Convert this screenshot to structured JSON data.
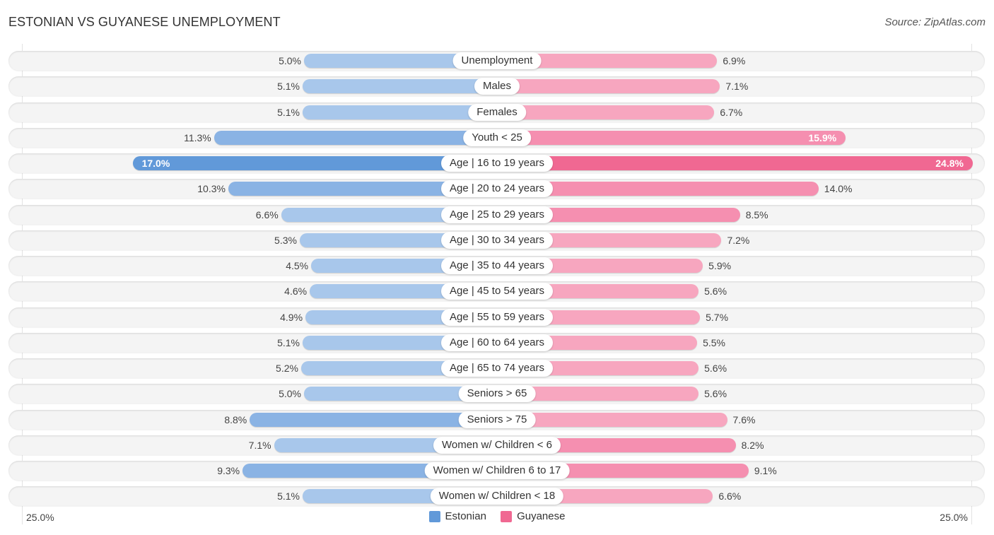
{
  "title": "ESTONIAN VS GUYANESE UNEMPLOYMENT",
  "source": "Source: ZipAtlas.com",
  "colors": {
    "estonian_strong": "#6199d9",
    "estonian_mid": "#8ab3e4",
    "estonian_light": "#a8c7eb",
    "guyanese_strong": "#f06892",
    "guyanese_mid": "#f58fb0",
    "guyanese_light": "#f7a6bf"
  },
  "chart_data": {
    "type": "bar",
    "orientation": "horizontal-diverging",
    "title": "ESTONIAN VS GUYANESE UNEMPLOYMENT",
    "xlabel": "",
    "ylabel": "",
    "axis_min_label": "25.0%",
    "axis_max_label": "25.0%",
    "xlim": [
      0,
      25
    ],
    "legend_position": "bottom-center",
    "categories": [
      "Unemployment",
      "Males",
      "Females",
      "Youth < 25",
      "Age | 16 to 19 years",
      "Age | 20 to 24 years",
      "Age | 25 to 29 years",
      "Age | 30 to 34 years",
      "Age | 35 to 44 years",
      "Age | 45 to 54 years",
      "Age | 55 to 59 years",
      "Age | 60 to 64 years",
      "Age | 65 to 74 years",
      "Seniors > 65",
      "Seniors > 75",
      "Women w/ Children < 6",
      "Women w/ Children 6 to 17",
      "Women w/ Children < 18"
    ],
    "series": [
      {
        "name": "Estonian",
        "side": "left",
        "values": [
          5.0,
          5.1,
          5.1,
          11.3,
          17.0,
          10.3,
          6.6,
          5.3,
          4.5,
          4.6,
          4.9,
          5.1,
          5.2,
          5.0,
          8.8,
          7.1,
          9.3,
          5.1
        ],
        "labels": [
          "5.0%",
          "5.1%",
          "5.1%",
          "11.3%",
          "17.0%",
          "10.3%",
          "6.6%",
          "5.3%",
          "4.5%",
          "4.6%",
          "4.9%",
          "5.1%",
          "5.2%",
          "5.0%",
          "8.8%",
          "7.1%",
          "9.3%",
          "5.1%"
        ]
      },
      {
        "name": "Guyanese",
        "side": "right",
        "values": [
          6.9,
          7.1,
          6.7,
          15.9,
          24.8,
          14.0,
          8.5,
          7.2,
          5.9,
          5.6,
          5.7,
          5.5,
          5.6,
          5.6,
          7.6,
          8.2,
          9.1,
          6.6
        ],
        "labels": [
          "6.9%",
          "7.1%",
          "6.7%",
          "15.9%",
          "24.8%",
          "14.0%",
          "8.5%",
          "7.2%",
          "5.9%",
          "5.6%",
          "5.7%",
          "5.5%",
          "5.6%",
          "5.6%",
          "7.6%",
          "8.2%",
          "9.1%",
          "6.6%"
        ]
      }
    ]
  },
  "legend": [
    {
      "name": "Estonian",
      "color": "#6199d9"
    },
    {
      "name": "Guyanese",
      "color": "#f06892"
    }
  ]
}
